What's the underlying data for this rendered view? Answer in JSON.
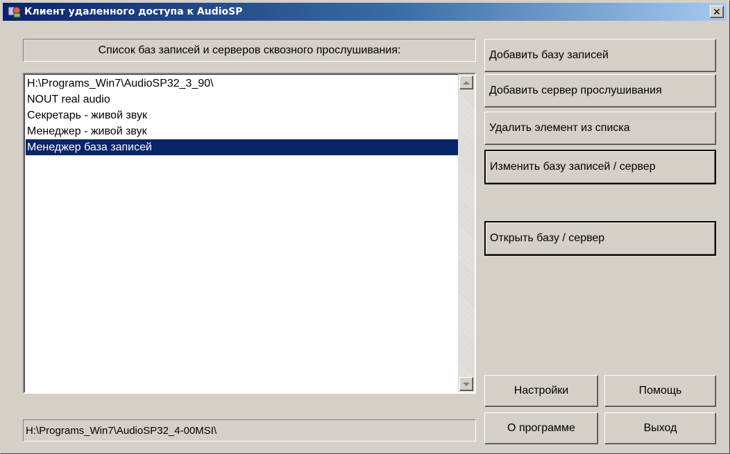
{
  "window": {
    "title": "Клиент удаленного доступа к AudioSP",
    "close_glyph": "✕"
  },
  "list": {
    "label": "Список баз записей и серверов сквозного прослушивания:",
    "items": [
      {
        "text": "H:\\Programs_Win7\\AudioSP32_3_90\\",
        "selected": false
      },
      {
        "text": "NOUT real audio",
        "selected": false
      },
      {
        "text": "Секретарь - живой звук",
        "selected": false
      },
      {
        "text": "Менеджер - живой звук",
        "selected": false
      },
      {
        "text": "Менеджер база записей",
        "selected": true
      }
    ]
  },
  "buttons": {
    "add_db": "Добавить базу записей",
    "add_server": "Добавить сервер прослушивания",
    "delete_item": "Удалить элемент из списка",
    "edit": "Изменить базу записей / сервер",
    "open": "Открыть базу / сервер",
    "settings": "Настройки",
    "help": "Помощь",
    "about": "О программе",
    "exit": "Выход"
  },
  "status": {
    "path": "H:\\Programs_Win7\\AudioSP32_4-00MSI\\"
  },
  "icons": {
    "app": "app-icon",
    "close": "close-icon",
    "scroll_up": "scroll-up-arrow-icon",
    "scroll_down": "scroll-down-arrow-icon"
  },
  "colors": {
    "selection": "#0a246a",
    "face": "#d4d0c8"
  }
}
